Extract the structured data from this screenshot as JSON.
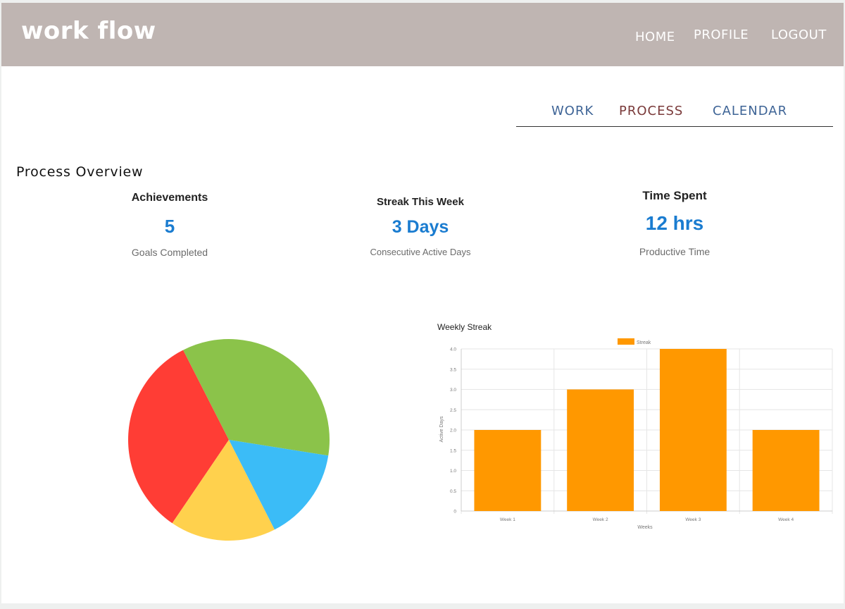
{
  "header": {
    "logo": "work flow",
    "nav": [
      {
        "label": "HOME"
      },
      {
        "label": "PROFILE"
      },
      {
        "label": "LOGOUT"
      }
    ]
  },
  "tabs": [
    {
      "label": "WORK",
      "color": "#3e6496"
    },
    {
      "label": "PROCESS",
      "color": "#7a3a3a",
      "active": true
    },
    {
      "label": "CALENDAR",
      "color": "#3e6496"
    }
  ],
  "overview": {
    "title": "Process Overview",
    "stats": [
      {
        "title": "Achievements",
        "value": "5",
        "label": "Goals Completed"
      },
      {
        "title": "Streak This Week",
        "value": "3 Days",
        "label": "Consecutive Active Days"
      },
      {
        "title": "Time Spent",
        "value": "12 hrs",
        "label": "Productive Time"
      }
    ]
  },
  "chart_data": [
    {
      "type": "pie",
      "values": [
        33,
        35,
        15,
        17
      ],
      "colors": [
        "#ff3d35",
        "#8bc34a",
        "#3bbcf7",
        "#ffd14d"
      ]
    },
    {
      "type": "bar",
      "title": "Weekly Streak",
      "categories": [
        "Week 1",
        "Week 2",
        "Week 3",
        "Week 4"
      ],
      "series": [
        {
          "name": "Streak",
          "values": [
            2,
            3,
            4,
            2
          ],
          "color": "#ff9800"
        }
      ],
      "xlabel": "Weeks",
      "ylabel": "Active Days",
      "ylim": [
        0,
        4
      ],
      "yticks": [
        "0",
        "0.5",
        "1.0",
        "1.5",
        "2.0",
        "2.5",
        "3.0",
        "3.5",
        "4.0"
      ],
      "grid": true,
      "legend": "top"
    }
  ]
}
